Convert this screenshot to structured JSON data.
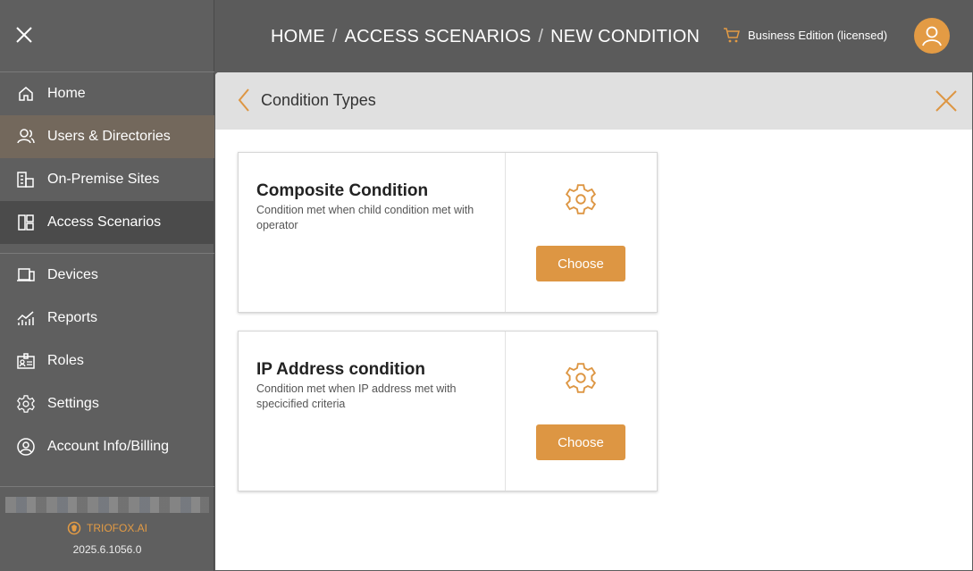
{
  "sidebar": {
    "items": [
      {
        "label": "Home",
        "icon": "home-icon"
      },
      {
        "label": "Users & Directories",
        "icon": "users-icon"
      },
      {
        "label": "On-Premise Sites",
        "icon": "building-icon"
      },
      {
        "label": "Access Scenarios",
        "icon": "layout-icon"
      },
      {
        "label": "Devices",
        "icon": "devices-icon"
      },
      {
        "label": "Reports",
        "icon": "chart-icon"
      },
      {
        "label": "Roles",
        "icon": "id-card-icon"
      },
      {
        "label": "Settings",
        "icon": "gear-icon"
      },
      {
        "label": "Account Info/Billing",
        "icon": "account-icon"
      }
    ],
    "brand": "TRIOFOX.AI",
    "version": "2025.6.1056.0"
  },
  "header": {
    "breadcrumb": [
      "HOME",
      "ACCESS SCENARIOS",
      "NEW CONDITION"
    ],
    "separator": "/",
    "edition": "Business Edition (licensed)"
  },
  "panel": {
    "title": "Condition Types",
    "cards": [
      {
        "title": "Composite Condition",
        "description": "Condition met when child condition met with operator",
        "button": "Choose"
      },
      {
        "title": "IP Address condition",
        "description": "Condition met when IP address met with specicified criteria",
        "button": "Choose"
      }
    ]
  },
  "colors": {
    "accent": "#dd9643",
    "sidebar": "#5f5f5f",
    "active_item": "#4b4b4b",
    "hover_item": "#73685c"
  }
}
